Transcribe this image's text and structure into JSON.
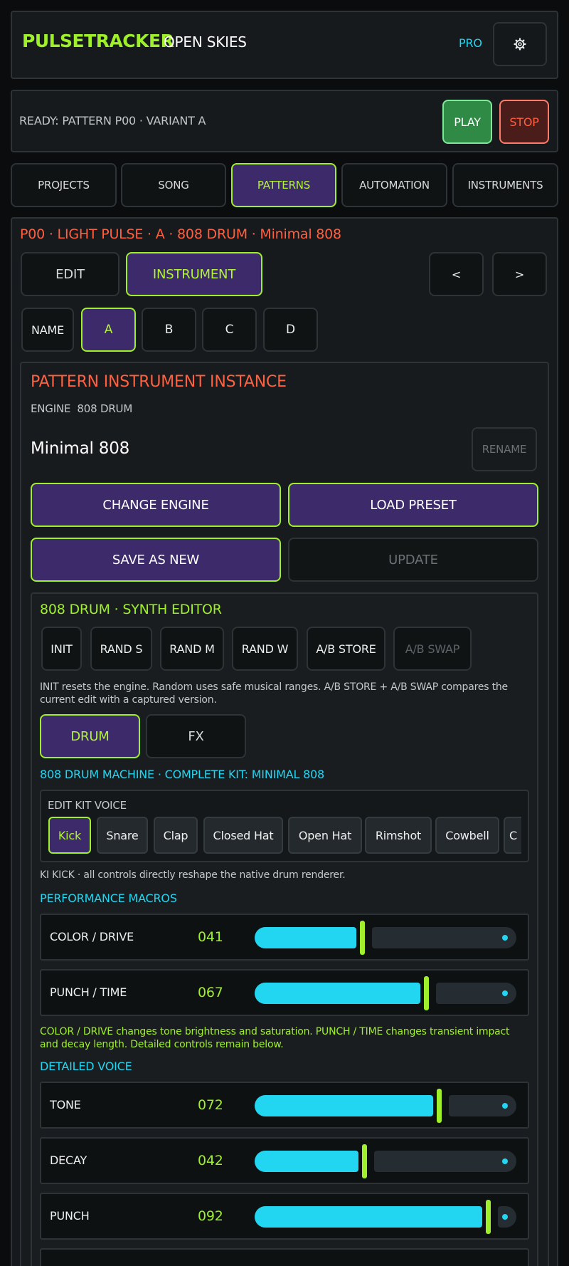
{
  "header": {
    "brand": "PULSETRACKER",
    "project": "OPEN SKIES",
    "pro_badge": "PRO",
    "settings_icon": "gear-icon"
  },
  "transport": {
    "status": "READY: PATTERN P00 · VARIANT A",
    "play": "PLAY",
    "stop": "STOP"
  },
  "tabs": [
    "PROJECTS",
    "SONG",
    "PATTERNS",
    "AUTOMATION",
    "INSTRUMENTS"
  ],
  "active_tab": "PATTERNS",
  "pattern": {
    "crumb": "P00 · LIGHT PULSE · A · 808 DRUM · Minimal 808",
    "mode_edit": "EDIT",
    "mode_instrument": "INSTRUMENT",
    "prev": "<",
    "next": ">",
    "variant_name": "NAME",
    "variants": [
      "A",
      "B",
      "C",
      "D"
    ],
    "active_variant": "A"
  },
  "instance": {
    "title": "PATTERN INSTRUMENT INSTANCE",
    "engine_line": "ENGINE  808 DRUM",
    "name": "Minimal 808",
    "rename": "RENAME",
    "change_engine": "CHANGE ENGINE",
    "load_preset": "LOAD PRESET",
    "save_as_new": "SAVE AS NEW",
    "update": "UPDATE"
  },
  "editor": {
    "title": "808 DRUM · SYNTH EDITOR",
    "tools": [
      "INIT",
      "RAND S",
      "RAND M",
      "RAND W",
      "A/B STORE",
      "A/B SWAP"
    ],
    "help": "INIT resets the engine. Random uses safe musical ranges. A/B STORE + A/B SWAP compares the current edit with a captured version.",
    "tab_drum": "DRUM",
    "tab_fx": "FX",
    "kit_title": "808 DRUM MACHINE · COMPLETE KIT: MINIMAL 808",
    "kit_voice_label": "EDIT KIT VOICE",
    "voices": [
      "Kick",
      "Snare",
      "Clap",
      "Closed Hat",
      "Open Hat",
      "Rimshot",
      "Cowbell",
      "C"
    ],
    "active_voice": "Kick",
    "voice_note": "KI KICK · all controls directly reshape the native drum renderer.",
    "macros_title": "PERFORMANCE MACROS",
    "macros": [
      {
        "label": "COLOR / DRIVE",
        "value": "041",
        "level": 0.41
      },
      {
        "label": "PUNCH / TIME",
        "value": "067",
        "level": 0.67
      }
    ],
    "macro_note": "COLOR / DRIVE changes tone brightness and saturation. PUNCH / TIME changes transient impact and decay length. Detailed controls remain below.",
    "detail_title": "DETAILED VOICE",
    "details": [
      {
        "label": "TONE",
        "value": "072",
        "level": 0.72
      },
      {
        "label": "DECAY",
        "value": "042",
        "level": 0.42
      },
      {
        "label": "PUNCH",
        "value": "092",
        "level": 0.92
      }
    ]
  },
  "colors": {
    "accent_lime": "#9ff02a",
    "accent_cyan": "#22d6f2",
    "accent_red": "#ff6040",
    "selected_bg": "#3d2a6b",
    "play_green": "#2f8a46"
  }
}
